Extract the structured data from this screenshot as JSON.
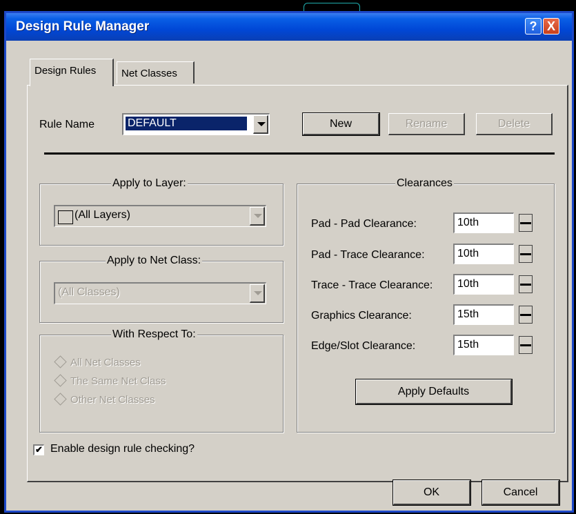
{
  "window": {
    "title": "Design Rule Manager",
    "help_label": "?",
    "close_label": "X"
  },
  "tabs": [
    {
      "label": "Design Rules",
      "active": true
    },
    {
      "label": "Net Classes",
      "active": false
    }
  ],
  "rule_name": {
    "label": "Rule Name",
    "value": "DEFAULT"
  },
  "buttons": {
    "new": "New",
    "rename": "Rename",
    "delete": "Delete",
    "apply_defaults": "Apply Defaults",
    "ok": "OK",
    "cancel": "Cancel"
  },
  "apply_to_layer": {
    "title": "Apply to Layer:",
    "value": "(All Layers)"
  },
  "apply_to_net_class": {
    "title": "Apply to Net Class:",
    "value": "(All Classes)"
  },
  "with_respect_to": {
    "title": "With Respect To:",
    "options": [
      "All Net Classes",
      "The Same Net Class",
      "Other Net Classes"
    ]
  },
  "clearances": {
    "title": "Clearances",
    "rows": [
      {
        "label": "Pad - Pad Clearance:",
        "value": "10th"
      },
      {
        "label": "Pad - Trace Clearance:",
        "value": "10th"
      },
      {
        "label": "Trace - Trace Clearance:",
        "value": "10th"
      },
      {
        "label": "Graphics Clearance:",
        "value": "15th"
      },
      {
        "label": "Edge/Slot Clearance:",
        "value": "15th"
      }
    ]
  },
  "checkbox": {
    "label": "Enable design rule checking?",
    "checked": true,
    "mark": "✔"
  },
  "colors": {
    "title_bar": "#0047d6",
    "dialog_bg": "#d4d0c8",
    "selection": "#0a246a"
  }
}
